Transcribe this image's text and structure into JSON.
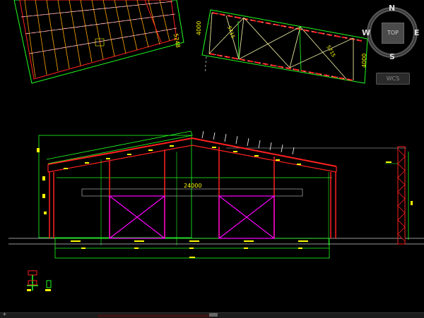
{
  "viewcube": {
    "top_label": "TOP",
    "north": "N",
    "south": "S",
    "east": "E",
    "west": "W"
  },
  "wcs_label": "WCS",
  "dimensions": {
    "main_span": "24000",
    "roof_left": "5248",
    "top_left": "4000",
    "top_right": "4000",
    "diag_a": "5715",
    "diag_b": "5715"
  },
  "colors": {
    "background": "#000000",
    "frame": "#ff2020",
    "dimension": "#20ff20",
    "text": "#ffff00",
    "bracing": "#ff00ff",
    "purlin": "#ffa500",
    "grid": "#ffffff"
  }
}
